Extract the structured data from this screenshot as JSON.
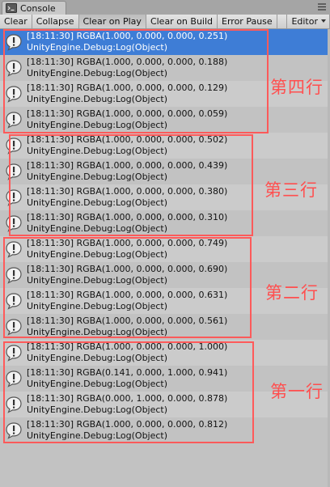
{
  "window": {
    "tab_title": "Console"
  },
  "toolbar": {
    "buttons": [
      "Clear",
      "Collapse",
      "Clear on Play",
      "Clear on Build",
      "Error Pause"
    ],
    "editor_label": "Editor"
  },
  "log_entries": [
    {
      "time": "[18:11:30]",
      "message": "RGBA(1.000, 0.000, 0.000, 0.251)",
      "source": "UnityEngine.Debug:Log(Object)",
      "selected": true
    },
    {
      "time": "[18:11:30]",
      "message": "RGBA(1.000, 0.000, 0.000, 0.188)",
      "source": "UnityEngine.Debug:Log(Object)"
    },
    {
      "time": "[18:11:30]",
      "message": "RGBA(1.000, 0.000, 0.000, 0.129)",
      "source": "UnityEngine.Debug:Log(Object)"
    },
    {
      "time": "[18:11:30]",
      "message": "RGBA(1.000, 0.000, 0.000, 0.059)",
      "source": "UnityEngine.Debug:Log(Object)"
    },
    {
      "time": "[18:11:30]",
      "message": "RGBA(1.000, 0.000, 0.000, 0.502)",
      "source": "UnityEngine.Debug:Log(Object)"
    },
    {
      "time": "[18:11:30]",
      "message": "RGBA(1.000, 0.000, 0.000, 0.439)",
      "source": "UnityEngine.Debug:Log(Object)"
    },
    {
      "time": "[18:11:30]",
      "message": "RGBA(1.000, 0.000, 0.000, 0.380)",
      "source": "UnityEngine.Debug:Log(Object)"
    },
    {
      "time": "[18:11:30]",
      "message": "RGBA(1.000, 0.000, 0.000, 0.310)",
      "source": "UnityEngine.Debug:Log(Object)"
    },
    {
      "time": "[18:11:30]",
      "message": "RGBA(1.000, 0.000, 0.000, 0.749)",
      "source": "UnityEngine.Debug:Log(Object)"
    },
    {
      "time": "[18:11:30]",
      "message": "RGBA(1.000, 0.000, 0.000, 0.690)",
      "source": "UnityEngine.Debug:Log(Object)"
    },
    {
      "time": "[18:11:30]",
      "message": "RGBA(1.000, 0.000, 0.000, 0.631)",
      "source": "UnityEngine.Debug:Log(Object)"
    },
    {
      "time": "[18:11:30]",
      "message": "RGBA(1.000, 0.000, 0.000, 0.561)",
      "source": "UnityEngine.Debug:Log(Object)"
    },
    {
      "time": "[18:11:30]",
      "message": "RGBA(1.000, 0.000, 0.000, 1.000)",
      "source": "UnityEngine.Debug:Log(Object)"
    },
    {
      "time": "[18:11:30]",
      "message": "RGBA(0.141, 0.000, 1.000, 0.941)",
      "source": "UnityEngine.Debug:Log(Object)"
    },
    {
      "time": "[18:11:30]",
      "message": "RGBA(0.000, 1.000, 0.000, 0.878)",
      "source": "UnityEngine.Debug:Log(Object)"
    },
    {
      "time": "[18:11:30]",
      "message": "RGBA(1.000, 0.000, 0.000, 0.812)",
      "source": "UnityEngine.Debug:Log(Object)"
    }
  ],
  "annotations": [
    {
      "label": "第四行"
    },
    {
      "label": "第三行"
    },
    {
      "label": "第二行"
    },
    {
      "label": "第一行"
    }
  ],
  "colors": {
    "selection": "#3e7dd6",
    "annotation": "#ff5a5a"
  },
  "icons": {
    "tab": "console-icon",
    "menu": "menu-icon",
    "log_entry": "info-speech-bubble-icon"
  }
}
